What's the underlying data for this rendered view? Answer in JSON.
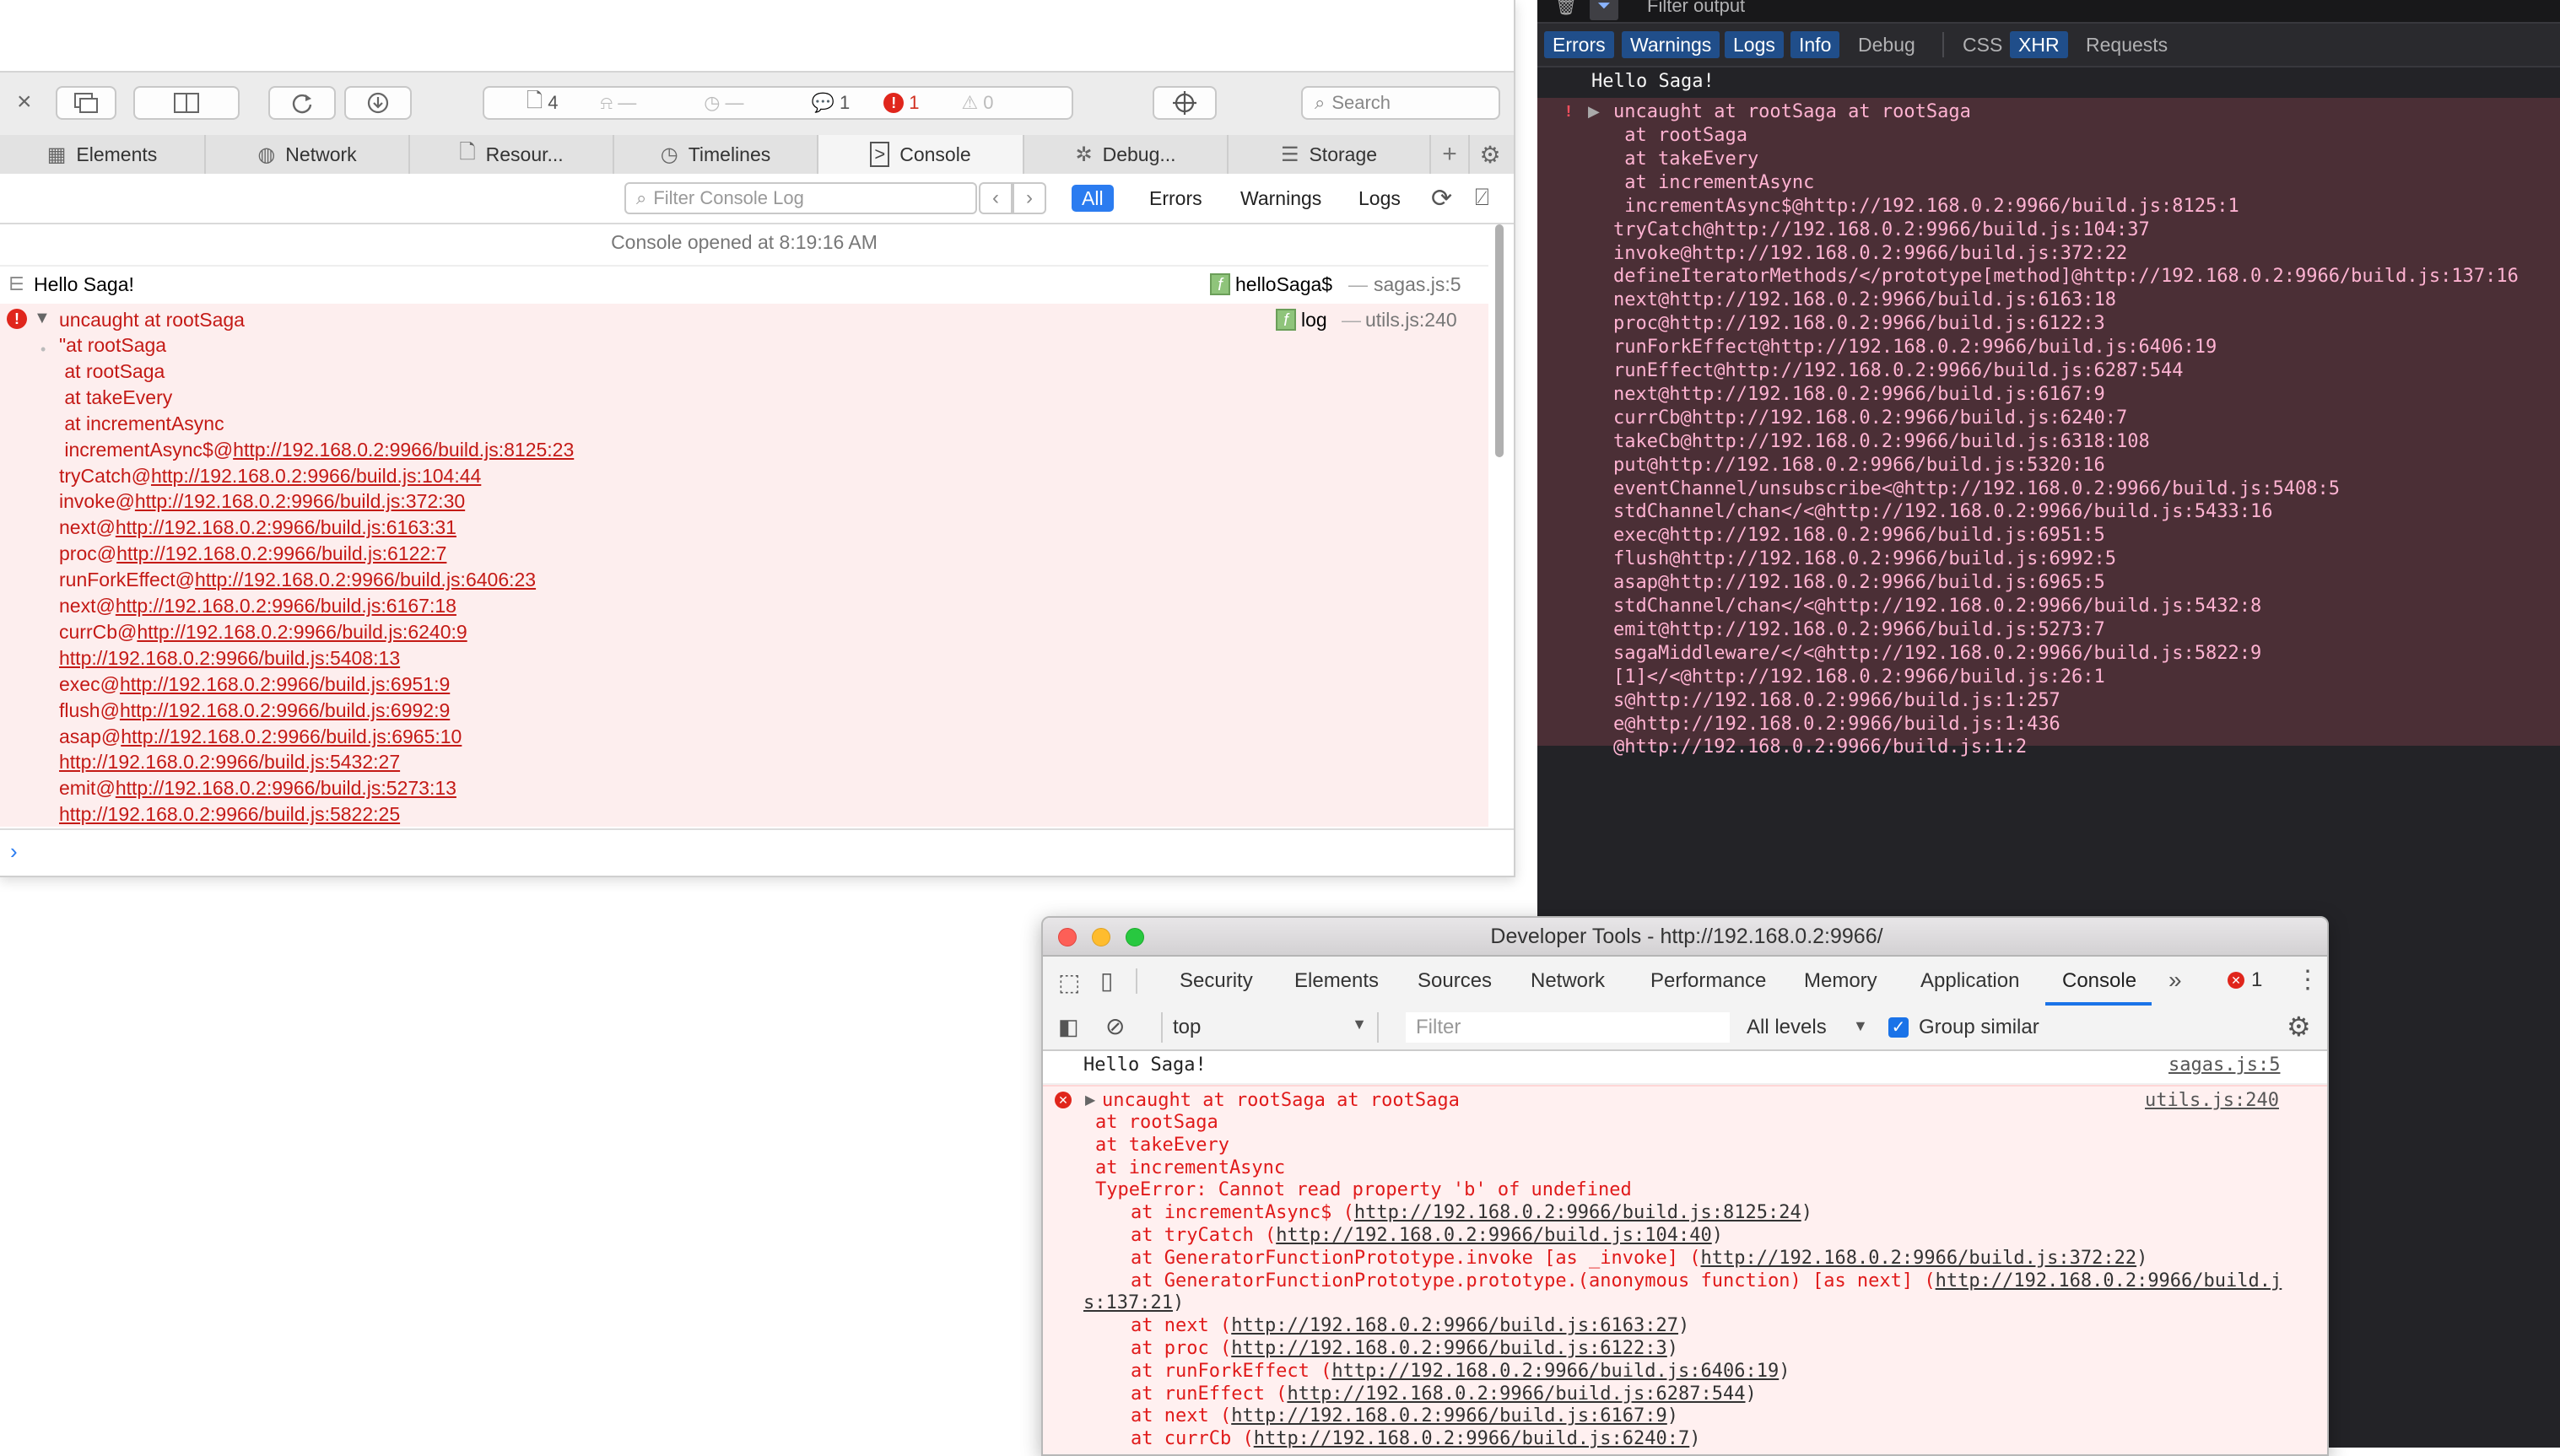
{
  "safari": {
    "toolbar": {
      "pages_count": "4",
      "messages_count": "1",
      "errors_count": "1",
      "warnings_count": "0",
      "search_placeholder": "Search"
    },
    "tabs": [
      "Elements",
      "Network",
      "Resour...",
      "Timelines",
      "Console",
      "Debug...",
      "Storage"
    ],
    "filter": {
      "placeholder": "Filter Console Log",
      "levels": [
        "All",
        "Errors",
        "Warnings",
        "Logs"
      ]
    },
    "console": {
      "opened": "Console opened at 8:19:16 AM",
      "hello": {
        "text": "Hello Saga!",
        "source_fn": "helloSaga$",
        "source_file": "sagas.js:5"
      },
      "error": {
        "title": "uncaught at rootSaga",
        "source_fn": "log",
        "source_file": "utils.js:240",
        "lines": [
          {
            "pre": "\"at rootSaga",
            "url": ""
          },
          {
            "pre": " at rootSaga",
            "url": ""
          },
          {
            "pre": " at takeEvery",
            "url": ""
          },
          {
            "pre": " at incrementAsync",
            "url": ""
          },
          {
            "pre": " incrementAsync$@",
            "url": "http://192.168.0.2:9966/build.js:8125:23"
          },
          {
            "pre": "tryCatch@",
            "url": "http://192.168.0.2:9966/build.js:104:44"
          },
          {
            "pre": "invoke@",
            "url": "http://192.168.0.2:9966/build.js:372:30"
          },
          {
            "pre": "next@",
            "url": "http://192.168.0.2:9966/build.js:6163:31"
          },
          {
            "pre": "proc@",
            "url": "http://192.168.0.2:9966/build.js:6122:7"
          },
          {
            "pre": "runForkEffect@",
            "url": "http://192.168.0.2:9966/build.js:6406:23"
          },
          {
            "pre": "next@",
            "url": "http://192.168.0.2:9966/build.js:6167:18"
          },
          {
            "pre": "currCb@",
            "url": "http://192.168.0.2:9966/build.js:6240:9"
          },
          {
            "pre": "",
            "url": "http://192.168.0.2:9966/build.js:5408:13"
          },
          {
            "pre": "exec@",
            "url": "http://192.168.0.2:9966/build.js:6951:9"
          },
          {
            "pre": "flush@",
            "url": "http://192.168.0.2:9966/build.js:6992:9"
          },
          {
            "pre": "asap@",
            "url": "http://192.168.0.2:9966/build.js:6965:10"
          },
          {
            "pre": "",
            "url": "http://192.168.0.2:9966/build.js:5432:27"
          },
          {
            "pre": "emit@",
            "url": "http://192.168.0.2:9966/build.js:5273:13"
          },
          {
            "pre": "",
            "url": "http://192.168.0.2:9966/build.js:5822:25"
          }
        ]
      }
    }
  },
  "firefox": {
    "top_label": "Filter output",
    "filters": [
      "Errors",
      "Warnings",
      "Logs",
      "Info",
      "Debug",
      "CSS",
      "XHR",
      "Requests"
    ],
    "hello": "Hello Saga!",
    "error_title": "uncaught at rootSaga at rootSaga",
    "lines": [
      " at rootSaga",
      " at takeEvery",
      " at incrementAsync",
      " incrementAsync$@http://192.168.0.2:9966/build.js:8125:1",
      "tryCatch@http://192.168.0.2:9966/build.js:104:37",
      "invoke@http://192.168.0.2:9966/build.js:372:22",
      "defineIteratorMethods/</prototype[method]@http://192.168.0.2:9966/build.js:137:16",
      "next@http://192.168.0.2:9966/build.js:6163:18",
      "proc@http://192.168.0.2:9966/build.js:6122:3",
      "runForkEffect@http://192.168.0.2:9966/build.js:6406:19",
      "runEffect@http://192.168.0.2:9966/build.js:6287:544",
      "next@http://192.168.0.2:9966/build.js:6167:9",
      "currCb@http://192.168.0.2:9966/build.js:6240:7",
      "takeCb@http://192.168.0.2:9966/build.js:6318:108",
      "put@http://192.168.0.2:9966/build.js:5320:16",
      "eventChannel/unsubscribe<@http://192.168.0.2:9966/build.js:5408:5",
      "stdChannel/chan</<@http://192.168.0.2:9966/build.js:5433:16",
      "exec@http://192.168.0.2:9966/build.js:6951:5",
      "flush@http://192.168.0.2:9966/build.js:6992:5",
      "asap@http://192.168.0.2:9966/build.js:6965:5",
      "stdChannel/chan</<@http://192.168.0.2:9966/build.js:5432:8",
      "emit@http://192.168.0.2:9966/build.js:5273:7",
      "sagaMiddleware/</<@http://192.168.0.2:9966/build.js:5822:9",
      "[1]</<@http://192.168.0.2:9966/build.js:26:1",
      "s@http://192.168.0.2:9966/build.js:1:257",
      "e@http://192.168.0.2:9966/build.js:1:436",
      "@http://192.168.0.2:9966/build.js:1:2"
    ]
  },
  "chrome": {
    "title": "Developer Tools - http://192.168.0.2:9966/",
    "tabs": [
      "Security",
      "Elements",
      "Sources",
      "Network",
      "Performance",
      "Memory",
      "Application",
      "Console"
    ],
    "error_count": "1",
    "context": "top",
    "filter_placeholder": "Filter",
    "levels": "All levels",
    "group_similar": "Group similar",
    "hello": {
      "text": "Hello Saga!",
      "source": "sagas.js:5"
    },
    "error": {
      "title": "uncaught at rootSaga at rootSaga",
      "source": "utils.js:240",
      "lines": [
        {
          "indent": 0,
          "pre": "at rootSaga",
          "url": "",
          "post": ""
        },
        {
          "indent": 0,
          "pre": "at takeEvery",
          "url": "",
          "post": ""
        },
        {
          "indent": 0,
          "pre": "at incrementAsync",
          "url": "",
          "post": ""
        },
        {
          "indent": 0,
          "pre": "TypeError: Cannot read property 'b' of undefined",
          "url": "",
          "post": ""
        },
        {
          "indent": 1,
          "pre": "at incrementAsync$ (",
          "url": "http://192.168.0.2:9966/build.js:8125:24",
          "post": ")"
        },
        {
          "indent": 1,
          "pre": "at tryCatch (",
          "url": "http://192.168.0.2:9966/build.js:104:40",
          "post": ")"
        },
        {
          "indent": 1,
          "pre": "at GeneratorFunctionPrototype.invoke [as _invoke] (",
          "url": "http://192.168.0.2:9966/build.js:372:22",
          "post": ")"
        },
        {
          "indent": 1,
          "pre": "at GeneratorFunctionPrototype.prototype.(anonymous function) [as next] (",
          "url": "http://192.168.0.2:9966/build.j",
          "post": ""
        },
        {
          "indent": -1,
          "pre": "",
          "url": "s:137:21",
          "post": ")"
        },
        {
          "indent": 1,
          "pre": "at next (",
          "url": "http://192.168.0.2:9966/build.js:6163:27",
          "post": ")"
        },
        {
          "indent": 1,
          "pre": "at proc (",
          "url": "http://192.168.0.2:9966/build.js:6122:3",
          "post": ")"
        },
        {
          "indent": 1,
          "pre": "at runForkEffect (",
          "url": "http://192.168.0.2:9966/build.js:6406:19",
          "post": ")"
        },
        {
          "indent": 1,
          "pre": "at runEffect (",
          "url": "http://192.168.0.2:9966/build.js:6287:544",
          "post": ")"
        },
        {
          "indent": 1,
          "pre": "at next (",
          "url": "http://192.168.0.2:9966/build.js:6167:9",
          "post": ")"
        },
        {
          "indent": 1,
          "pre": "at currCb (",
          "url": "http://192.168.0.2:9966/build.js:6240:7",
          "post": ")"
        }
      ]
    }
  },
  "colors": {
    "safari_error": "#c41a16",
    "safari_error_bg": "#fdeeee",
    "ff_error_text": "#ffb3d2",
    "ff_error_bg": "#4b2f36",
    "chrome_error": "#e01a1a",
    "accent_blue": "#2b7cf0"
  }
}
